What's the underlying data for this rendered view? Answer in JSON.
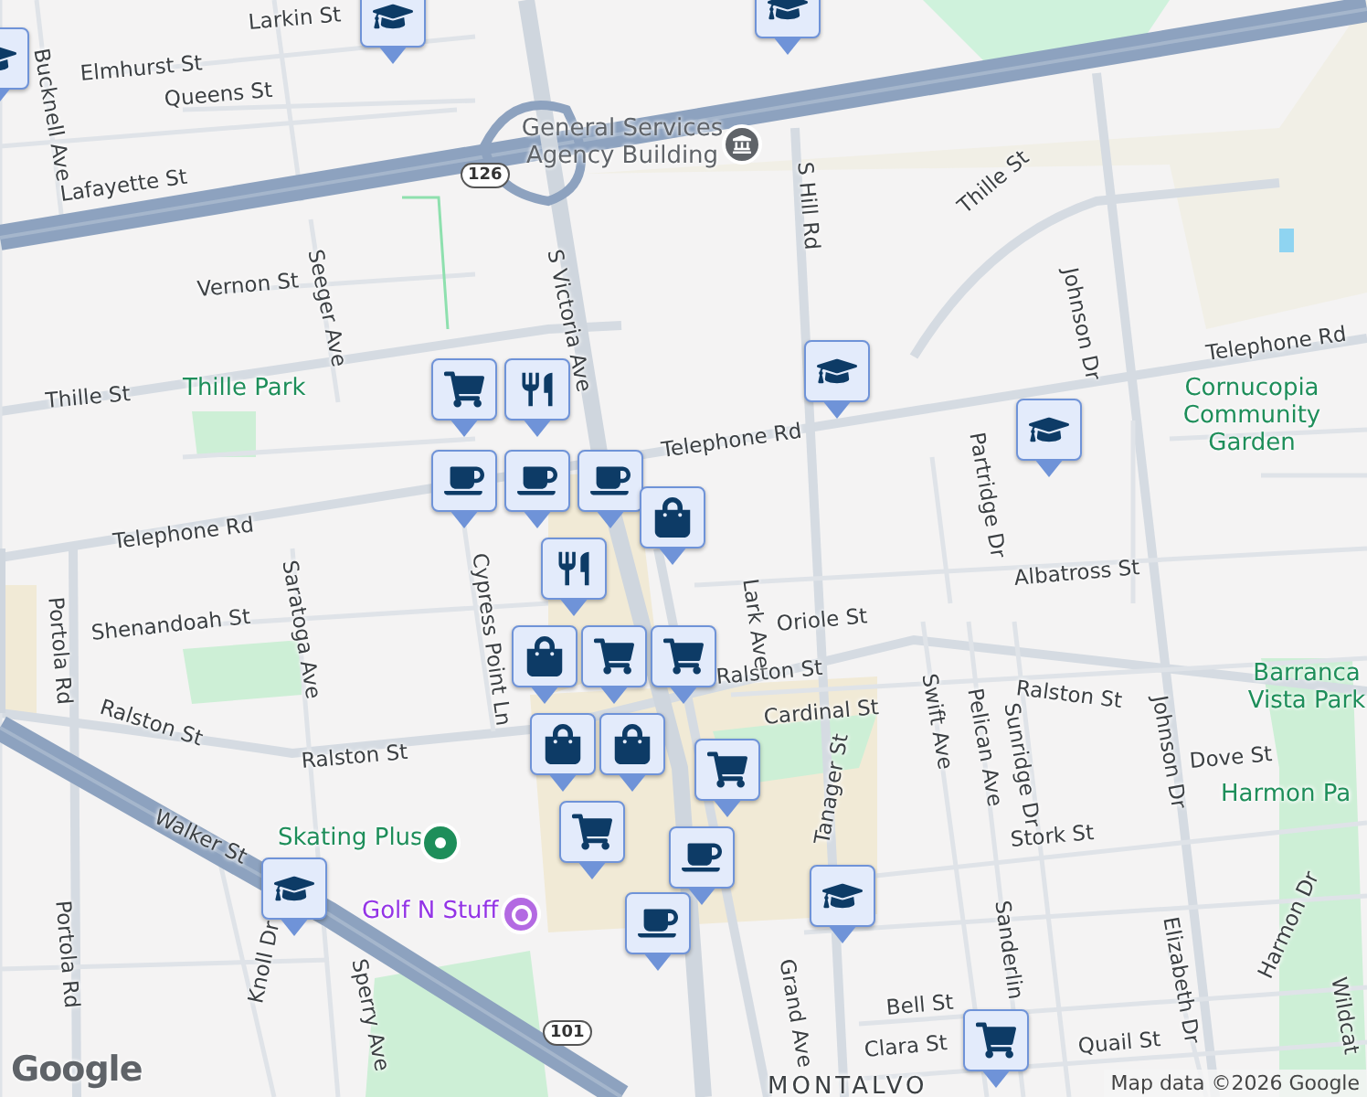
{
  "map": {
    "labels": [
      {
        "kind": "street",
        "text": "Larkin St"
      },
      {
        "kind": "street",
        "text": "Elmhurst St"
      },
      {
        "kind": "street",
        "text": "Queens St"
      },
      {
        "kind": "street",
        "text": "Bucknell Ave"
      },
      {
        "kind": "street",
        "text": "Lafayette St"
      },
      {
        "kind": "street",
        "text": "Vernon St"
      },
      {
        "kind": "street",
        "text": "Seeger Ave"
      },
      {
        "kind": "street",
        "text": "Thille St"
      },
      {
        "kind": "park",
        "text": "Thille Park"
      },
      {
        "kind": "street",
        "text": "Telephone Rd"
      },
      {
        "kind": "street",
        "text": "S Victoria Ave"
      },
      {
        "kind": "landmark",
        "text": "General Services Agency Building"
      },
      {
        "kind": "street",
        "text": "S Hill Rd"
      },
      {
        "kind": "street",
        "text": "Thille St"
      },
      {
        "kind": "street",
        "text": "Johnson Dr"
      },
      {
        "kind": "street",
        "text": "Telephone Rd"
      },
      {
        "kind": "street",
        "text": "Telephone Rd"
      },
      {
        "kind": "park",
        "text": "Cornucopia Community Garden"
      },
      {
        "kind": "street",
        "text": "Partridge Dr"
      },
      {
        "kind": "street",
        "text": "Portola Rd"
      },
      {
        "kind": "street",
        "text": "Shenandoah St"
      },
      {
        "kind": "street",
        "text": "Saratoga Ave"
      },
      {
        "kind": "street",
        "text": "Cypress Point Ln"
      },
      {
        "kind": "street",
        "text": "Ralston St"
      },
      {
        "kind": "street",
        "text": "Ralston St"
      },
      {
        "kind": "street",
        "text": "Ralston St"
      },
      {
        "kind": "street",
        "text": "Walker St"
      },
      {
        "kind": "park",
        "text": "Skating Plus"
      },
      {
        "kind": "fun",
        "text": "Golf N Stuff"
      },
      {
        "kind": "street",
        "text": "Portola Rd"
      },
      {
        "kind": "street",
        "text": "Knoll Dr"
      },
      {
        "kind": "street",
        "text": "Sperry Ave"
      },
      {
        "kind": "street",
        "text": "Lark Ave"
      },
      {
        "kind": "street",
        "text": "Oriole St"
      },
      {
        "kind": "street",
        "text": "Albatross St"
      },
      {
        "kind": "street",
        "text": "Cardinal St"
      },
      {
        "kind": "street",
        "text": "Ralston St"
      },
      {
        "kind": "street",
        "text": "Swift Ave"
      },
      {
        "kind": "street",
        "text": "Pelican Ave"
      },
      {
        "kind": "street",
        "text": "Sunridge Dr"
      },
      {
        "kind": "street",
        "text": "Johnson Dr"
      },
      {
        "kind": "park",
        "text": "Barranca Vista Park"
      },
      {
        "kind": "street",
        "text": "Dove St"
      },
      {
        "kind": "park",
        "text": "Harmon Pa"
      },
      {
        "kind": "street",
        "text": "Stork St"
      },
      {
        "kind": "street",
        "text": "Tanager St"
      },
      {
        "kind": "street",
        "text": "Grand Ave"
      },
      {
        "kind": "street",
        "text": "Elizabeth Dr"
      },
      {
        "kind": "street",
        "text": "Harmon Dr"
      },
      {
        "kind": "street",
        "text": "Bell St"
      },
      {
        "kind": "street",
        "text": "Clara St"
      },
      {
        "kind": "street",
        "text": "Quail St"
      },
      {
        "kind": "area",
        "text": "MONTALVO"
      },
      {
        "kind": "street",
        "text": "Sanderlin"
      },
      {
        "kind": "street",
        "text": "Wildcat"
      },
      {
        "kind": "shield",
        "text": "126"
      },
      {
        "kind": "shield",
        "text": "101"
      }
    ],
    "markers": [
      {
        "kind": "school"
      },
      {
        "kind": "school"
      },
      {
        "kind": "school"
      },
      {
        "kind": "school"
      },
      {
        "kind": "school"
      },
      {
        "kind": "school"
      },
      {
        "kind": "school"
      },
      {
        "kind": "grocery"
      },
      {
        "kind": "cafe"
      },
      {
        "kind": "restaurant"
      },
      {
        "kind": "cafe"
      },
      {
        "kind": "cafe"
      },
      {
        "kind": "shopping"
      },
      {
        "kind": "restaurant"
      },
      {
        "kind": "shopping"
      },
      {
        "kind": "grocery"
      },
      {
        "kind": "grocery"
      },
      {
        "kind": "shopping"
      },
      {
        "kind": "shopping"
      },
      {
        "kind": "cafe"
      },
      {
        "kind": "grocery"
      },
      {
        "kind": "grocery"
      },
      {
        "kind": "cafe"
      },
      {
        "kind": "grocery"
      }
    ],
    "logo": "Google",
    "attribution": "Map data ©2026 Google"
  }
}
